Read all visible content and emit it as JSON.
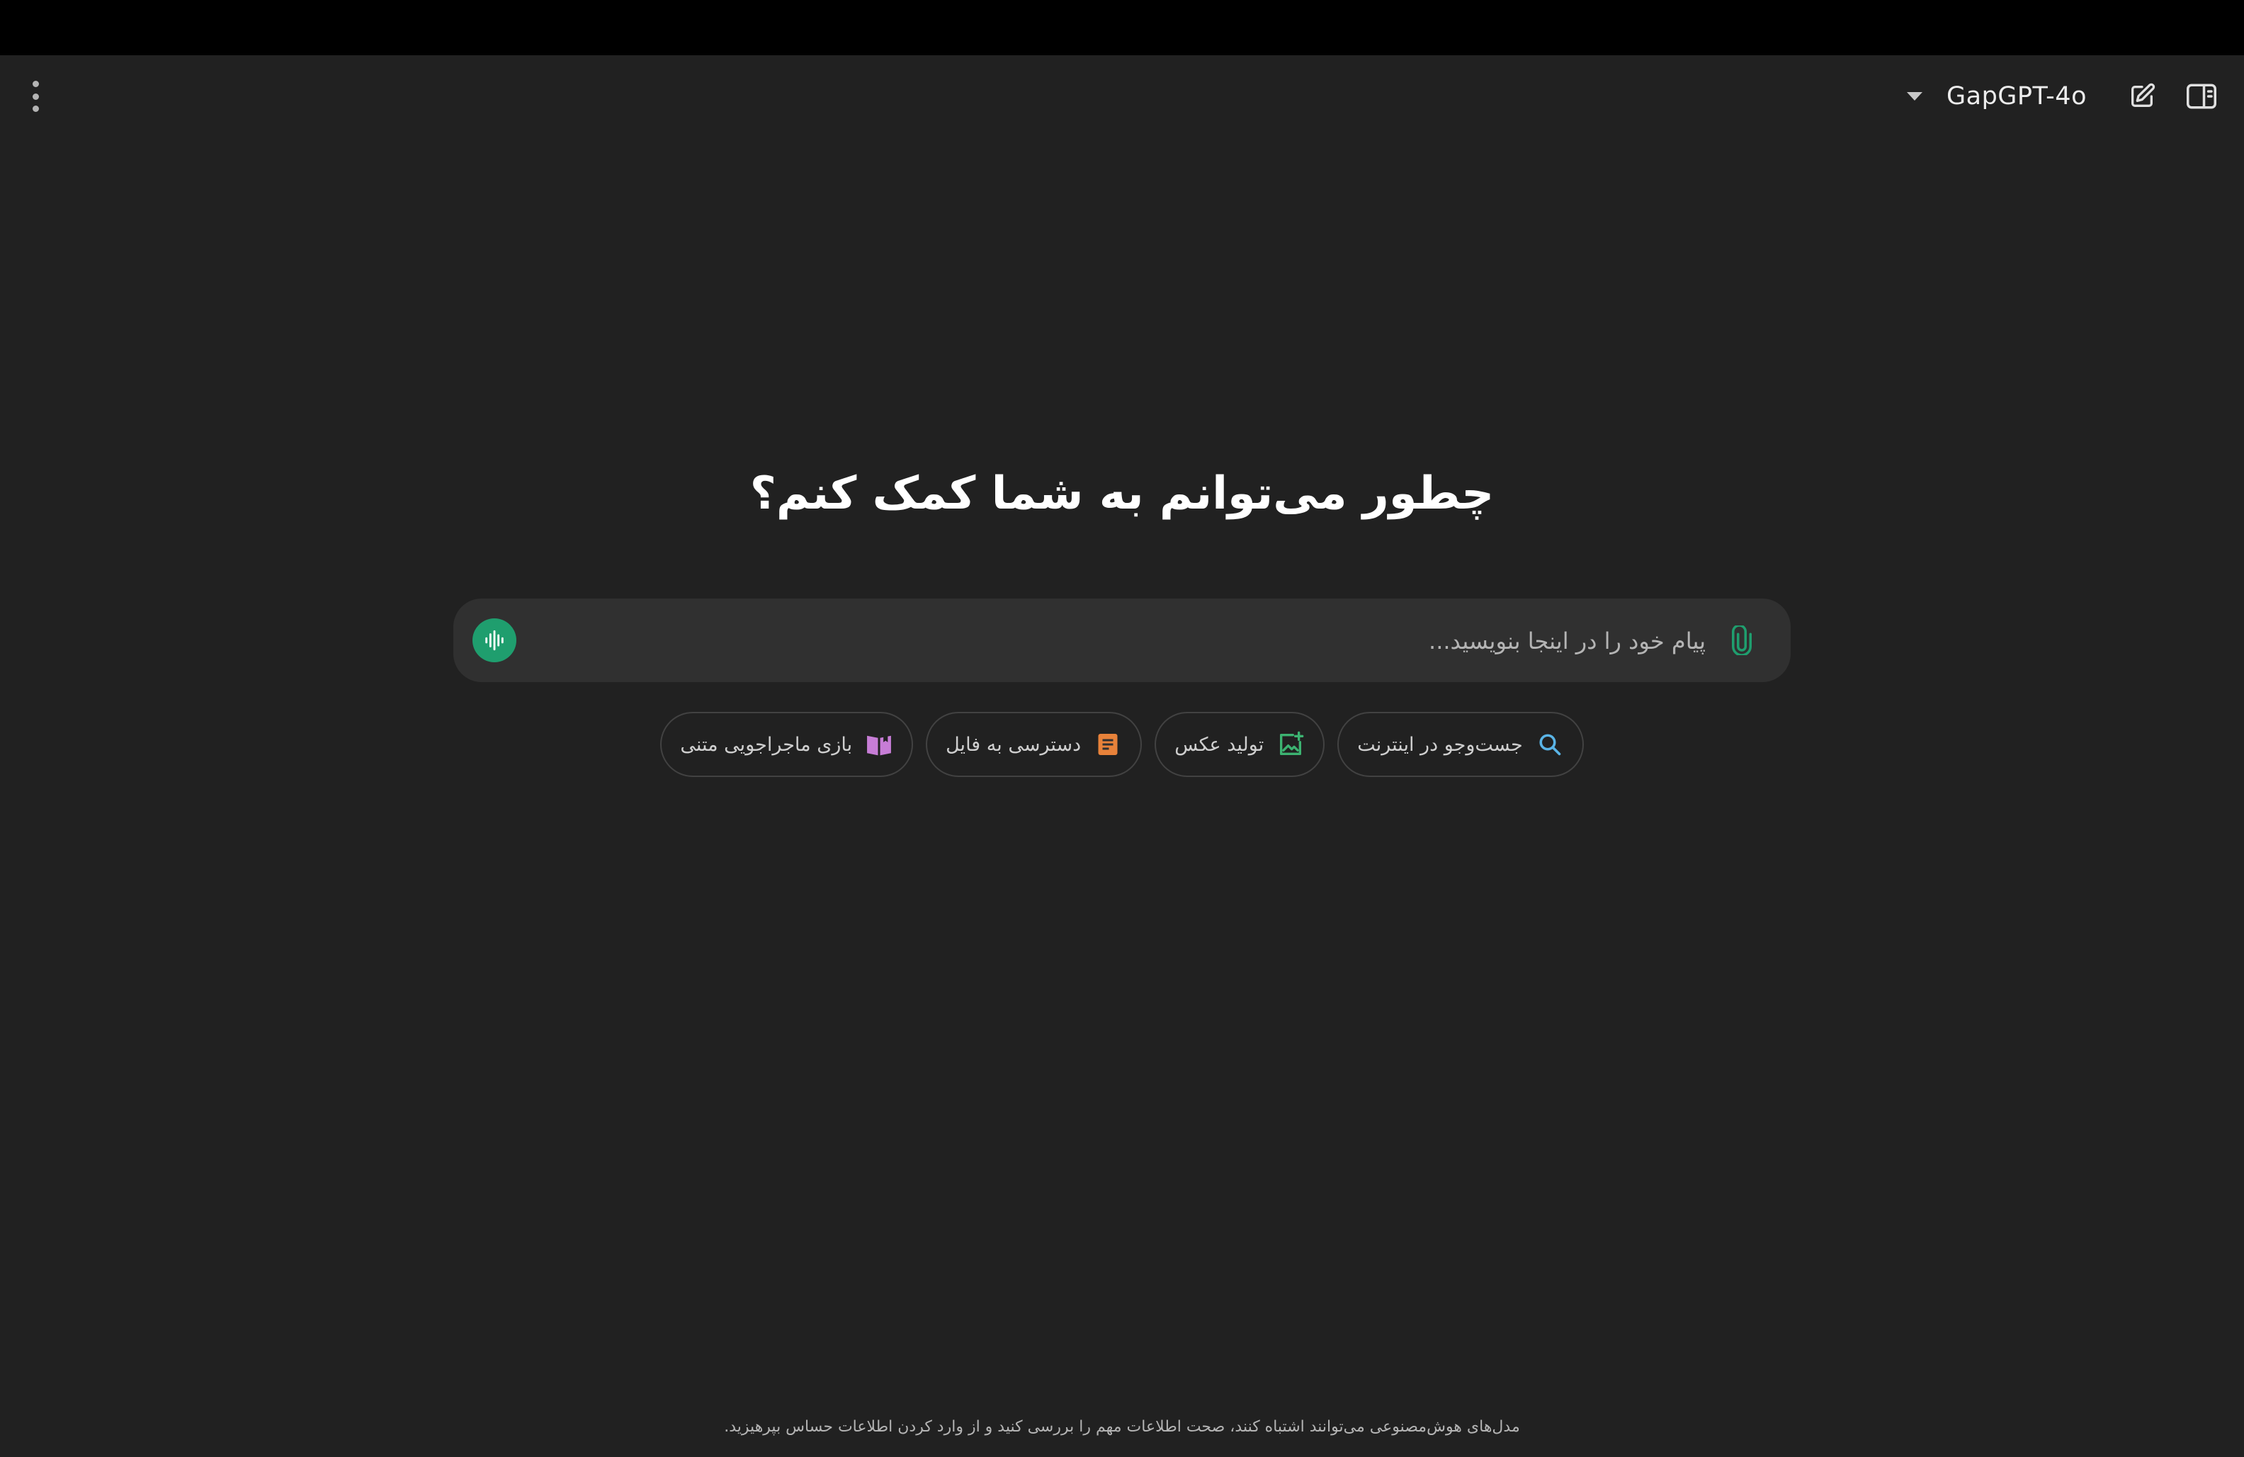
{
  "header": {
    "model_name": "GapGPT-4o",
    "icons": {
      "menu": "kebab-menu-icon",
      "dropdown": "chevron-down-icon",
      "new_chat": "edit-icon",
      "sidebar": "sidebar-toggle-icon"
    }
  },
  "main": {
    "headline": "چطور می‌توانم به شما کمک کنم؟"
  },
  "composer": {
    "placeholder": "پیام خود را در اینجا بنویسید...",
    "value": "",
    "voice_icon": "waveform-icon",
    "attach_icon": "paperclip-icon",
    "colors": {
      "voice_button": "#1f9e6e",
      "attach": "#1f9e6e"
    }
  },
  "chips": [
    {
      "label": "جست‌وجو در اینترنت",
      "icon": "search-icon",
      "color": "#5ab4e6"
    },
    {
      "label": "تولید عکس",
      "icon": "image-add-icon",
      "color": "#3cb371"
    },
    {
      "label": "دسترسی به فایل",
      "icon": "document-icon",
      "color": "#e8823a"
    },
    {
      "label": "بازی ماجراجویی متنی",
      "icon": "book-icon",
      "color": "#c77dd6"
    }
  ],
  "footer": {
    "disclaimer": "مدل‌های هوش‌مصنوعی می‌توانند اشتباه کنند، صحت اطلاعات مهم را بررسی کنید و از وارد کردن اطلاعات حساس بپرهیزید."
  }
}
